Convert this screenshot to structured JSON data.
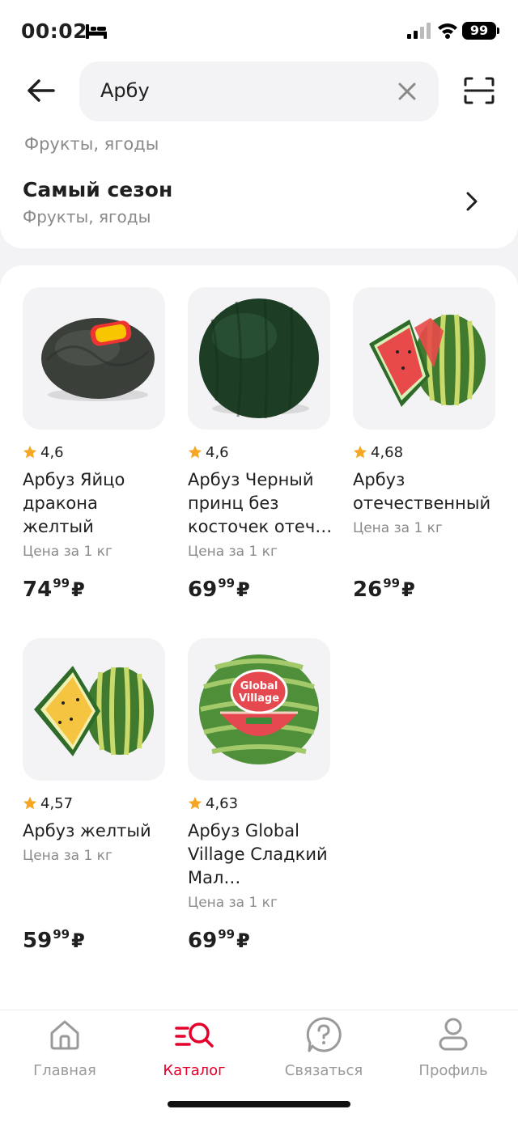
{
  "status_bar": {
    "time": "00:02",
    "battery": "99"
  },
  "search": {
    "value": "Арбу"
  },
  "category": {
    "peek_text": "Фрукты, ягоды",
    "title": "Самый сезон",
    "subtitle": "Фрукты, ягоды"
  },
  "products": [
    {
      "rating": "4,6",
      "name": "Арбуз Яйцо дракона желтый",
      "unit": "Цена за 1 кг",
      "price_main": "74",
      "price_sup": "99",
      "currency": "₽"
    },
    {
      "rating": "4,6",
      "name": "Арбуз Черный принц без косточек отеч…",
      "unit": "Цена за 1 кг",
      "price_main": "69",
      "price_sup": "99",
      "currency": "₽"
    },
    {
      "rating": "4,68",
      "name": "Арбуз отечественный",
      "unit": "Цена за 1 кг",
      "price_main": "26",
      "price_sup": "99",
      "currency": "₽"
    },
    {
      "rating": "4,57",
      "name": "Арбуз желтый",
      "unit": "Цена за 1 кг",
      "price_main": "59",
      "price_sup": "99",
      "currency": "₽"
    },
    {
      "rating": "4,63",
      "name": "Арбуз Global Village Сладкий Мал…",
      "unit": "Цена за 1 кг",
      "price_main": "69",
      "price_sup": "99",
      "currency": "₽",
      "logo_text": [
        "Global",
        "Village"
      ]
    }
  ],
  "tab_bar": {
    "tabs": [
      {
        "label": "Главная",
        "icon": "home-icon",
        "active": false
      },
      {
        "label": "Каталог",
        "icon": "catalog-icon",
        "active": true
      },
      {
        "label": "Связаться",
        "icon": "help-icon",
        "active": false
      },
      {
        "label": "Профиль",
        "icon": "profile-icon",
        "active": false
      }
    ]
  },
  "colors": {
    "accent": "#e4002b",
    "star": "#f5a623",
    "text": "#1f1f1f",
    "muted": "#8a8a8a",
    "background": "#f3f3f5"
  }
}
